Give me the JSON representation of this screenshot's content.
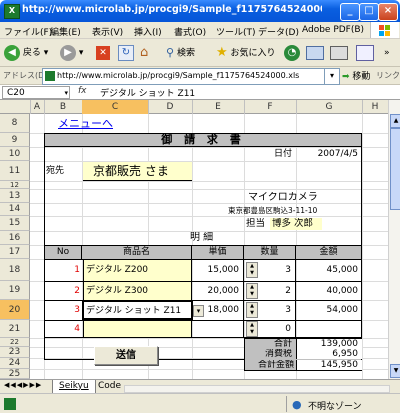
{
  "window": {
    "title": "http://www.microlab.jp/procgi9/Sample_f1175764524000.xls - Mic...",
    "app_icon": "excel-icon"
  },
  "menu": [
    "ファイル(F)",
    "編集(E)",
    "表示(V)",
    "挿入(I)",
    "書式(O)",
    "ツール(T)",
    "データ(D)",
    "Adobe PDF(B)"
  ],
  "toolbar": {
    "back_label": "戻る",
    "search_label": "検索",
    "favorites_label": "お気に入り"
  },
  "address": {
    "label": "アドレス(D)",
    "url": "http://www.microlab.jp/procgi9/Sample_f1175764524000.xls",
    "go_label": "移動",
    "links_label": "リンク"
  },
  "formula_bar": {
    "name_box": "C20",
    "content": "デジタル ショット Z11"
  },
  "columns": [
    "A",
    "B",
    "C",
    "D",
    "E",
    "F",
    "G",
    "H"
  ],
  "rows": [
    "8",
    "9",
    "10",
    "11",
    "12",
    "13",
    "14",
    "15",
    "16",
    "17",
    "18",
    "19",
    "20",
    "21",
    "22",
    "23",
    "24",
    "25"
  ],
  "invoice": {
    "menu_link": "メニューへ",
    "title": "御 請 求 書",
    "date_label": "日付",
    "date_value": "2007/4/5",
    "to_label": "宛先",
    "customer": "京都販売 さま",
    "company": "マイクロカメラ",
    "address": "東京都豊島区駒込3-11-10",
    "rep_label": "担当",
    "rep_name": "博多 次郎",
    "detail_label": "明 細",
    "headers": {
      "no": "No",
      "product": "商品名",
      "price": "単価",
      "qty": "数量",
      "amount": "金額"
    },
    "items": [
      {
        "no": "1",
        "product": "デジタル Z200",
        "price": "15,000",
        "qty": "3",
        "amount": "45,000"
      },
      {
        "no": "2",
        "product": "デジタル Z300",
        "price": "20,000",
        "qty": "2",
        "amount": "40,000"
      },
      {
        "no": "3",
        "product": "デジタル ショット Z11",
        "price": "18,000",
        "qty": "3",
        "amount": "54,000"
      },
      {
        "no": "4",
        "product": "",
        "price": "",
        "qty": "0",
        "amount": ""
      }
    ],
    "subtotal_label": "合計",
    "subtotal": "139,000",
    "tax_label": "消費税",
    "tax": "6,950",
    "total_label": "合計金額",
    "total": "145,950",
    "send_button": "送信"
  },
  "sheets": {
    "active": "Seikyu",
    "other": "Code"
  },
  "status": {
    "zone": "不明なゾーン"
  }
}
